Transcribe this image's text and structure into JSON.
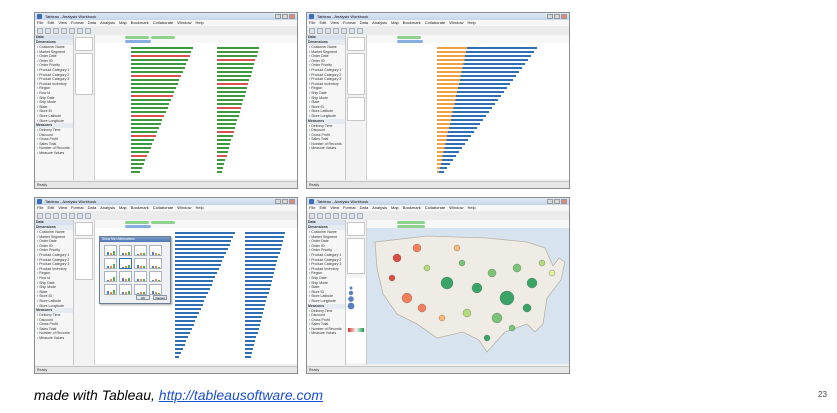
{
  "windows": [
    {
      "title": "Tableau - Analysis Workbook",
      "menu": [
        "File",
        "Edit",
        "View",
        "Format",
        "Data",
        "Analysis",
        "Map",
        "Bookmark",
        "Collaborate",
        "Window",
        "Help"
      ],
      "data_header": "Data",
      "dimensions_header": "Dimensions",
      "measures_header": "Measures",
      "dimensions": [
        "Customer Name",
        "Market Segment",
        "Order Date",
        "Order ID",
        "Order Priority",
        "Product Category 1",
        "Product Category 2",
        "Product Category 3",
        "Product Inventory",
        "Region",
        "Row Id",
        "Ship Date",
        "Ship Mode",
        "State",
        "Store ID",
        "Store Latitude",
        "Store Longitude"
      ],
      "measures": [
        "Delivery Time",
        "Discount",
        "Gross Profit",
        "Sales Total",
        "Number of Records",
        "Measure Values"
      ],
      "status": "Ready"
    },
    {
      "title": "Tableau - Analysis Workbook",
      "menu": [
        "File",
        "Edit",
        "View",
        "Format",
        "Data",
        "Analysis",
        "Map",
        "Bookmark",
        "Collaborate",
        "Window",
        "Help"
      ],
      "data_header": "Data",
      "dimensions_header": "Dimensions",
      "measures_header": "Measures",
      "dimensions": [
        "Customer Name",
        "Market Segment",
        "Order Date",
        "Order ID",
        "Order Priority",
        "Product Category 1",
        "Product Category 2",
        "Product Category 3",
        "Product Inventory",
        "Region",
        "Ship Date",
        "Ship Mode",
        "State",
        "Store ID",
        "Store Latitude",
        "Store Longitude"
      ],
      "measures": [
        "Delivery Time",
        "Discount",
        "Gross Profit",
        "Sales Total",
        "Number of Records",
        "Measure Values"
      ],
      "status": "Ready"
    },
    {
      "title": "Tableau - Analysis Workbook",
      "menu": [
        "File",
        "Edit",
        "View",
        "Format",
        "Data",
        "Analysis",
        "Map",
        "Bookmark",
        "Collaborate",
        "Window",
        "Help"
      ],
      "data_header": "Data",
      "dimensions_header": "Dimensions",
      "measures_header": "Measures",
      "dimensions": [
        "Customer Name",
        "Market Segment",
        "Order Date",
        "Order ID",
        "Order Priority",
        "Product Category 1",
        "Product Category 2",
        "Product Category 3",
        "Product Inventory",
        "Region",
        "Row Id",
        "Ship Date",
        "Ship Mode",
        "State",
        "Store ID",
        "Store Latitude",
        "Store Longitude"
      ],
      "measures": [
        "Delivery Time",
        "Discount",
        "Gross Profit",
        "Sales Total",
        "Number of Records",
        "Measure Values"
      ],
      "dialog_title": "Show Me! Alternatives",
      "dialog_ok": "OK",
      "dialog_cancel": "Cancel",
      "status": "Ready"
    },
    {
      "title": "Tableau - Analysis Workbook",
      "menu": [
        "File",
        "Edit",
        "View",
        "Format",
        "Data",
        "Analysis",
        "Map",
        "Bookmark",
        "Collaborate",
        "Window",
        "Help"
      ],
      "data_header": "Data",
      "dimensions_header": "Dimensions",
      "measures_header": "Measures",
      "dimensions": [
        "Customer Name",
        "Market Segment",
        "Order Date",
        "Order ID",
        "Order Priority",
        "Product Category 1",
        "Product Category 2",
        "Product Category 3",
        "Product Inventory",
        "Region",
        "Ship Date",
        "Ship Mode",
        "State",
        "Store ID",
        "Store Latitude",
        "Store Longitude"
      ],
      "measures": [
        "Delivery Time",
        "Discount",
        "Gross Profit",
        "Sales Total",
        "Number of Records",
        "Measure Values"
      ],
      "status": "Ready"
    }
  ],
  "caption_prefix": "made with Tableau, ",
  "caption_link": "http://tableausoftware.com",
  "page_number": "23",
  "colors": {
    "bar_blue": "#2f6fb3",
    "bar_green": "#3c9a3c",
    "bar_red": "#d9534f",
    "bar_orange": "#f0a040",
    "pill_green": "#8ed08e",
    "pill_blue": "#87aee0"
  }
}
